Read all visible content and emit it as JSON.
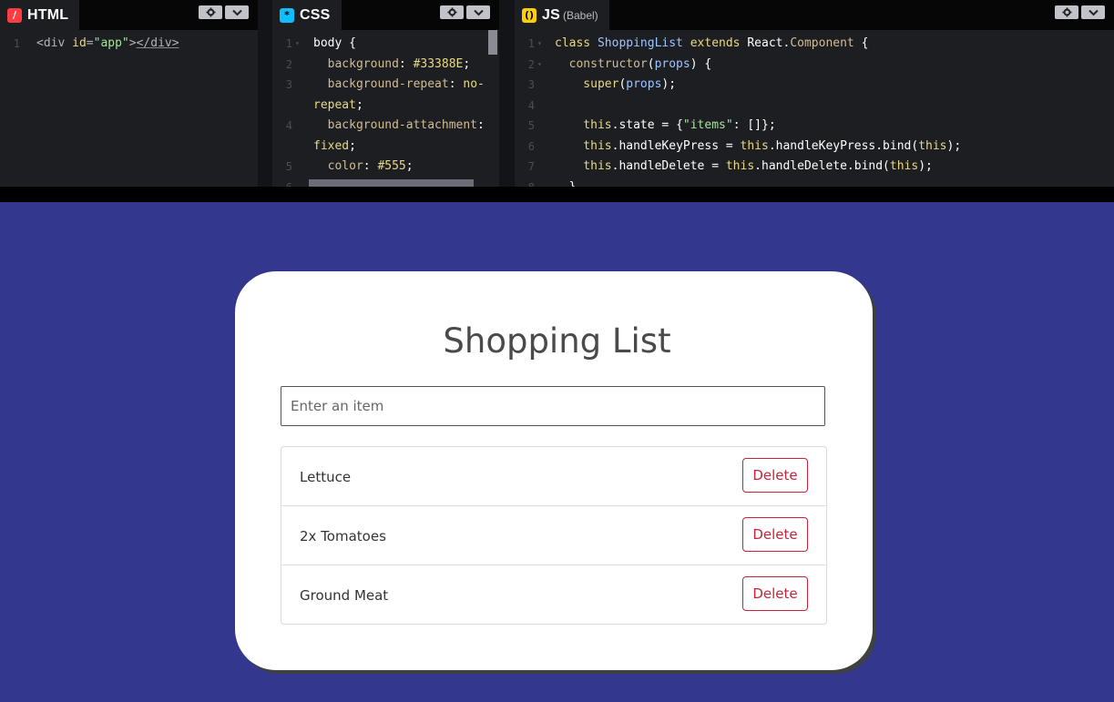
{
  "editors": {
    "html": {
      "tab": "HTML",
      "logo_glyph": "/",
      "lines": [
        {
          "n": "1",
          "fold": false,
          "tokens": [
            {
              "t": "<div ",
              "c": "t-tag"
            },
            {
              "t": "id",
              "c": "t-attr"
            },
            {
              "t": "=",
              "c": "t-tag"
            },
            {
              "t": "\"app\"",
              "c": "t-str"
            },
            {
              "t": ">",
              "c": "t-tag"
            },
            {
              "t": "</div>",
              "c": "t-tag t-ul"
            }
          ]
        }
      ]
    },
    "css": {
      "tab": "CSS",
      "logo_glyph": "*",
      "lines": [
        {
          "n": "1",
          "fold": true,
          "tokens": [
            {
              "t": "body {",
              "c": ""
            }
          ]
        },
        {
          "n": "2",
          "fold": false,
          "tokens": [
            {
              "t": "  background",
              "c": "t-prop"
            },
            {
              "t": ": ",
              "c": ""
            },
            {
              "t": "#33388E",
              "c": "t-val"
            },
            {
              "t": ";",
              "c": ""
            }
          ]
        },
        {
          "n": "3",
          "fold": false,
          "tokens": [
            {
              "t": "  background-repeat",
              "c": "t-prop"
            },
            {
              "t": ": ",
              "c": ""
            },
            {
              "t": "no-",
              "c": "t-val"
            }
          ]
        },
        {
          "n": "",
          "fold": false,
          "tokens": [
            {
              "t": "repeat",
              "c": "t-val"
            },
            {
              "t": ";",
              "c": ""
            }
          ]
        },
        {
          "n": "4",
          "fold": false,
          "tokens": [
            {
              "t": "  background-attachment",
              "c": "t-prop"
            },
            {
              "t": ":",
              "c": ""
            }
          ]
        },
        {
          "n": "",
          "fold": false,
          "tokens": [
            {
              "t": "fixed",
              "c": "t-val"
            },
            {
              "t": ";",
              "c": ""
            }
          ]
        },
        {
          "n": "5",
          "fold": false,
          "tokens": [
            {
              "t": "  color",
              "c": "t-prop"
            },
            {
              "t": ": ",
              "c": ""
            },
            {
              "t": "#555",
              "c": "t-val"
            },
            {
              "t": ";",
              "c": ""
            }
          ]
        },
        {
          "n": "6",
          "fold": false,
          "tokens": [
            {
              "t": "",
              "c": ""
            }
          ]
        }
      ]
    },
    "js": {
      "tab": "JS",
      "sub": "(Babel)",
      "logo_glyph": "()",
      "lines": [
        {
          "n": "1",
          "fold": true,
          "tokens": [
            {
              "t": "class ",
              "c": "t-kw"
            },
            {
              "t": "ShoppingList ",
              "c": "t-cls"
            },
            {
              "t": "extends ",
              "c": "t-kw"
            },
            {
              "t": "React",
              "c": ""
            },
            {
              "t": ".",
              "c": ""
            },
            {
              "t": "Component",
              "c": "t-prop"
            },
            {
              "t": " {",
              "c": ""
            }
          ]
        },
        {
          "n": "2",
          "fold": true,
          "tokens": [
            {
              "t": "  constructor",
              "c": "t-prop"
            },
            {
              "t": "(",
              "c": ""
            },
            {
              "t": "props",
              "c": "t-cls"
            },
            {
              "t": ") {",
              "c": ""
            }
          ]
        },
        {
          "n": "3",
          "fold": false,
          "tokens": [
            {
              "t": "    super",
              "c": "t-kw"
            },
            {
              "t": "(",
              "c": ""
            },
            {
              "t": "props",
              "c": "t-cls"
            },
            {
              "t": ");",
              "c": ""
            }
          ]
        },
        {
          "n": "4",
          "fold": false,
          "tokens": [
            {
              "t": "",
              "c": ""
            }
          ]
        },
        {
          "n": "5",
          "fold": false,
          "tokens": [
            {
              "t": "    this",
              "c": "t-kw"
            },
            {
              "t": ".state = {",
              "c": ""
            },
            {
              "t": "\"items\"",
              "c": "t-str"
            },
            {
              "t": ": []};",
              "c": ""
            }
          ]
        },
        {
          "n": "6",
          "fold": false,
          "tokens": [
            {
              "t": "    this",
              "c": "t-kw"
            },
            {
              "t": ".handleKeyPress = ",
              "c": ""
            },
            {
              "t": "this",
              "c": "t-kw"
            },
            {
              "t": ".handleKeyPress.bind(",
              "c": ""
            },
            {
              "t": "this",
              "c": "t-kw"
            },
            {
              "t": ");",
              "c": ""
            }
          ]
        },
        {
          "n": "7",
          "fold": false,
          "tokens": [
            {
              "t": "    this",
              "c": "t-kw"
            },
            {
              "t": ".handleDelete = ",
              "c": ""
            },
            {
              "t": "this",
              "c": "t-kw"
            },
            {
              "t": ".handleDelete.bind(",
              "c": ""
            },
            {
              "t": "this",
              "c": "t-kw"
            },
            {
              "t": ");",
              "c": ""
            }
          ]
        },
        {
          "n": "8",
          "fold": false,
          "tokens": [
            {
              "t": "  }",
              "c": ""
            }
          ]
        }
      ]
    },
    "settings_icon": "gear-icon",
    "collapse_icon": "chevron-down-icon"
  },
  "app": {
    "title": "Shopping List",
    "input_placeholder": "Enter an item",
    "input_value": "",
    "items": [
      {
        "label": "Lettuce",
        "button": "Delete"
      },
      {
        "label": "2x Tomatoes",
        "button": "Delete"
      },
      {
        "label": "Ground Meat",
        "button": "Delete"
      }
    ]
  },
  "colors": {
    "background": "#33388E",
    "card": "#FFFFFF",
    "danger": "#C8233A",
    "editor_bg": "#1D1E22"
  }
}
